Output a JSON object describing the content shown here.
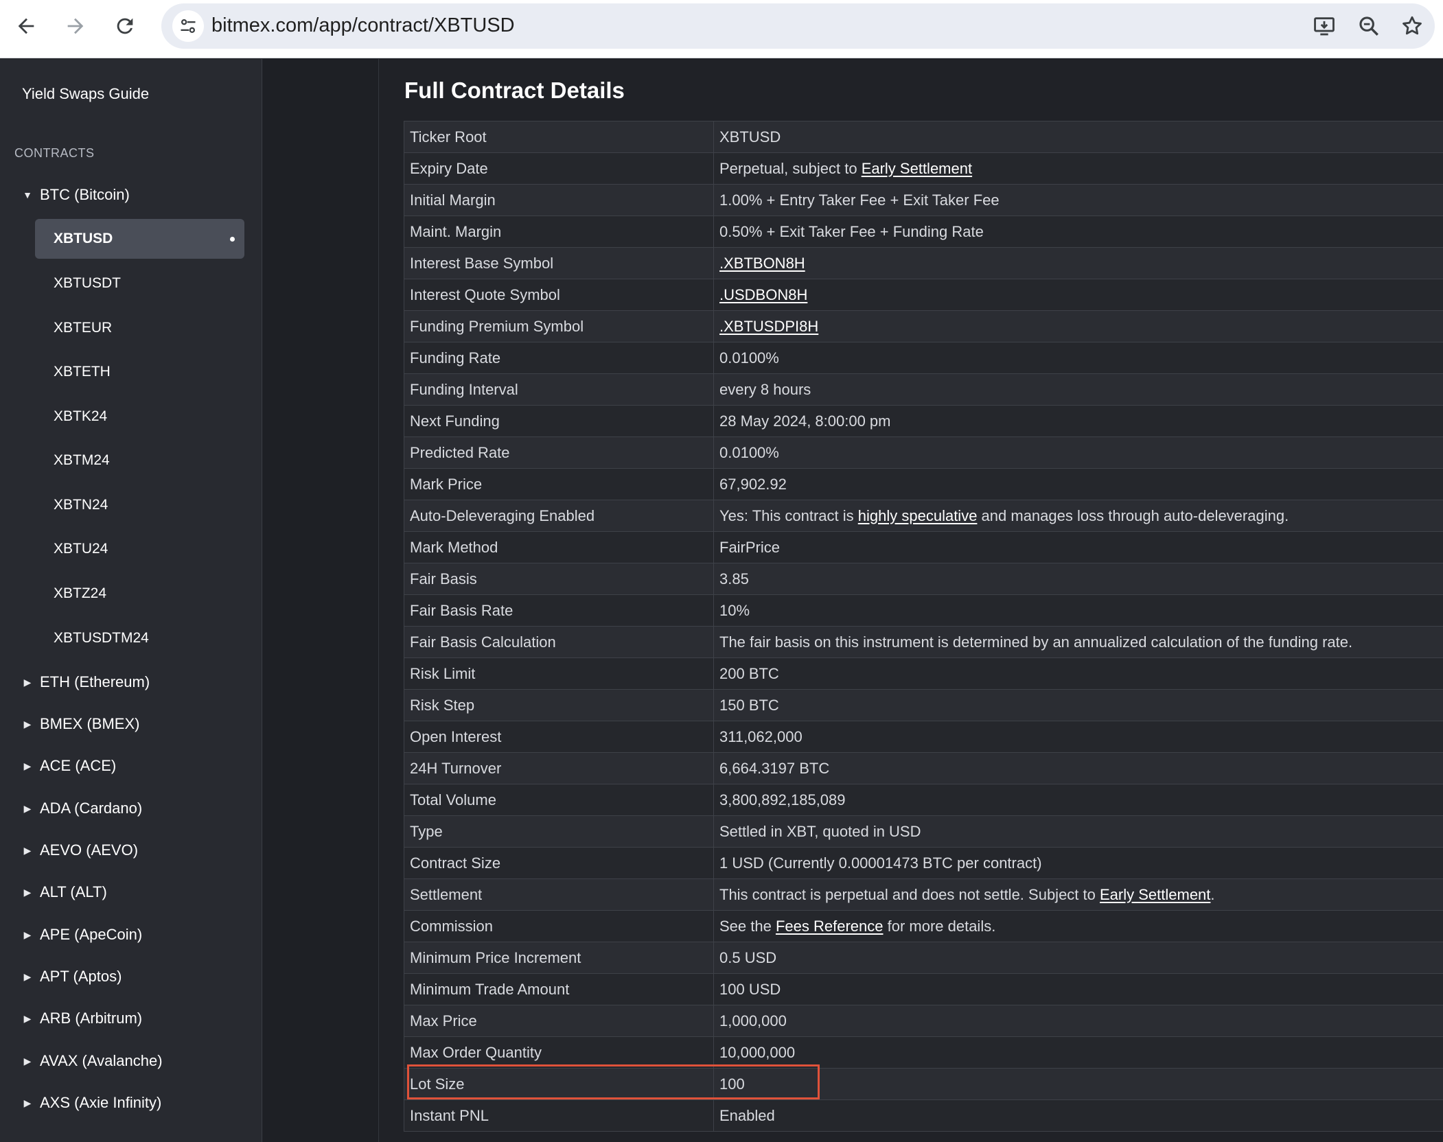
{
  "browser": {
    "url": "bitmex.com/app/contract/XBTUSD"
  },
  "sidebar": {
    "guide_link": "Yield Swaps Guide",
    "section_heading": "CONTRACTS",
    "expanded_group": "BTC (Bitcoin)",
    "btc_contracts": [
      "XBTUSD",
      "XBTUSDT",
      "XBTEUR",
      "XBTETH",
      "XBTK24",
      "XBTM24",
      "XBTN24",
      "XBTU24",
      "XBTZ24",
      "XBTUSDTM24"
    ],
    "active_contract": "XBTUSD",
    "collapsed_groups": [
      "ETH (Ethereum)",
      "BMEX (BMEX)",
      "ACE (ACE)",
      "ADA (Cardano)",
      "AEVO (AEVO)",
      "ALT (ALT)",
      "APE (ApeCoin)",
      "APT (Aptos)",
      "ARB (Arbitrum)",
      "AVAX (Avalanche)",
      "AXS (Axie Infinity)"
    ]
  },
  "main": {
    "title": "Full Contract Details",
    "highlighted_row": "Lot Size",
    "highlight_color": "#e0523a",
    "rows": [
      {
        "key": "Ticker Root",
        "value": "XBTUSD"
      },
      {
        "key": "Expiry Date",
        "value_pre": "Perpetual, subject to ",
        "link": "Early Settlement",
        "value_post": ""
      },
      {
        "key": "Initial Margin",
        "value": "1.00% + Entry Taker Fee + Exit Taker Fee"
      },
      {
        "key": "Maint. Margin",
        "value": "0.50% + Exit Taker Fee + Funding Rate"
      },
      {
        "key": "Interest Base Symbol",
        "value_pre": "",
        "link": ".XBTBON8H",
        "value_post": ""
      },
      {
        "key": "Interest Quote Symbol",
        "value_pre": "",
        "link": ".USDBON8H",
        "value_post": ""
      },
      {
        "key": "Funding Premium Symbol",
        "value_pre": "",
        "link": ".XBTUSDPI8H",
        "value_post": ""
      },
      {
        "key": "Funding Rate",
        "value": "0.0100%"
      },
      {
        "key": "Funding Interval",
        "value": "every 8 hours"
      },
      {
        "key": "Next Funding",
        "value": "28 May 2024, 8:00:00 pm"
      },
      {
        "key": "Predicted Rate",
        "value": "0.0100%"
      },
      {
        "key": "Mark Price",
        "value": "67,902.92"
      },
      {
        "key": "Auto-Deleveraging Enabled",
        "value_pre": "Yes: This contract is ",
        "link": "highly speculative",
        "value_post": " and manages loss through auto-deleveraging."
      },
      {
        "key": "Mark Method",
        "value": "FairPrice"
      },
      {
        "key": "Fair Basis",
        "value": "3.85"
      },
      {
        "key": "Fair Basis Rate",
        "value": "10%"
      },
      {
        "key": "Fair Basis Calculation",
        "value": "The fair basis on this instrument is determined by an annualized calculation of the funding rate."
      },
      {
        "key": "Risk Limit",
        "value": "200 BTC"
      },
      {
        "key": "Risk Step",
        "value": "150 BTC"
      },
      {
        "key": "Open Interest",
        "value": "311,062,000"
      },
      {
        "key": "24H Turnover",
        "value": "6,664.3197 BTC"
      },
      {
        "key": "Total Volume",
        "value": "3,800,892,185,089"
      },
      {
        "key": "Type",
        "value": "Settled in XBT, quoted in USD"
      },
      {
        "key": "Contract Size",
        "value": "1 USD (Currently 0.00001473 BTC per contract)"
      },
      {
        "key": "Settlement",
        "value_pre": "This contract is perpetual and does not settle. Subject to ",
        "link": "Early Settlement",
        "value_post": "."
      },
      {
        "key": "Commission",
        "value_pre": "See the ",
        "link": "Fees Reference",
        "value_post": " for more details."
      },
      {
        "key": "Minimum Price Increment",
        "value": "0.5 USD"
      },
      {
        "key": "Minimum Trade Amount",
        "value": "100 USD"
      },
      {
        "key": "Max Price",
        "value": "1,000,000"
      },
      {
        "key": "Max Order Quantity",
        "value": "10,000,000"
      },
      {
        "key": "Lot Size",
        "value": "100"
      },
      {
        "key": "Instant PNL",
        "value": "Enabled"
      }
    ]
  }
}
